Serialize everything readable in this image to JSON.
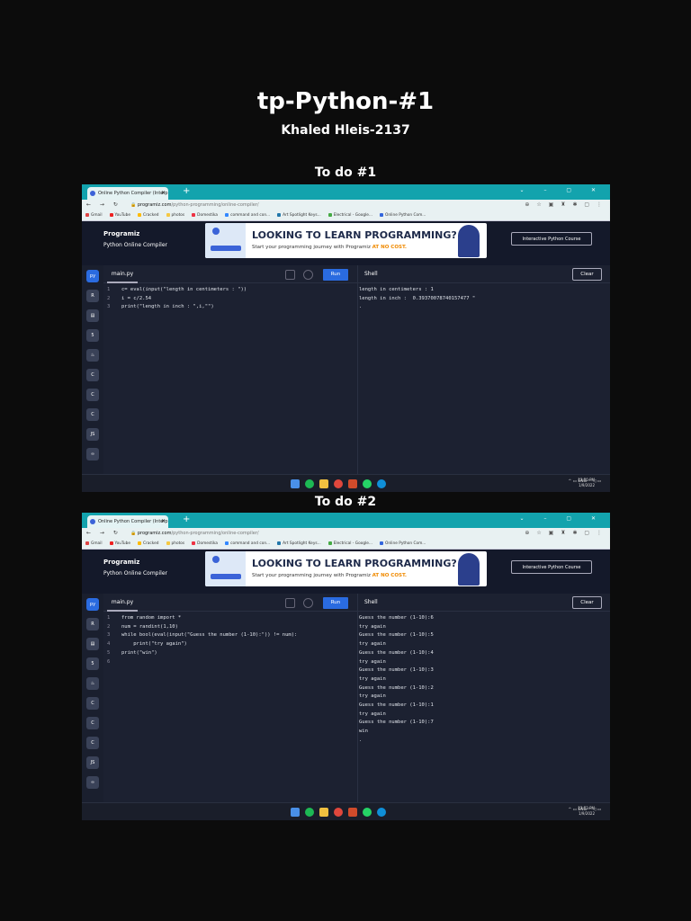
{
  "doc": {
    "title": "tp-Python-#1",
    "author": "Khaled Hleis-2137"
  },
  "sections": [
    {
      "label": "To do #1",
      "browser": {
        "tab_title": "Online Python Compiler (Interpr",
        "url_domain": "programiz.com",
        "url_path": "/python-programming/online-compiler/",
        "bookmarks": [
          "Gmail",
          "YouTube",
          "Cracked",
          "photos",
          "Domestika",
          "command and con...",
          "Art Spotlight Keys...",
          "Electrical - Google...",
          "Online Python Com..."
        ]
      },
      "site": {
        "logo": "Programiz",
        "subtitle": "Python Online Compiler",
        "banner_head": "LOOKING TO LEARN PROGRAMMING?",
        "banner_sub": "Start your programming journey with Programiz",
        "banner_sub_accent": "AT NO COST.",
        "cta": "Interactive Python Course"
      },
      "editor": {
        "tab": "main.py",
        "run": "Run",
        "shell": "Shell",
        "clear": "Clear",
        "lines": [
          "c= eval(input(\"length in centimeters : \"))",
          "i = c/2.54",
          "print(\"length in inch : \",i,\"\")"
        ]
      },
      "shell_lines": [
        "length in centimeters : 1",
        "length in inch :  0.39370078740157477 \"",
        "."
      ],
      "clock": {
        "time": "12:50 PM",
        "date": "1/9/2022"
      },
      "tray": "ENG"
    },
    {
      "label": "To do #2",
      "browser": {
        "tab_title": "Online Python Compiler (Interpr",
        "url_domain": "programiz.com",
        "url_path": "/python-programming/online-compiler/",
        "bookmarks": [
          "Gmail",
          "YouTube",
          "Cracked",
          "photos",
          "Domestika",
          "command and con...",
          "Art Spotlight Keys...",
          "Electrical - Google...",
          "Online Python Com..."
        ]
      },
      "site": {
        "logo": "Programiz",
        "subtitle": "Python Online Compiler",
        "banner_head": "LOOKING TO LEARN PROGRAMMING?",
        "banner_sub": "Start your programming journey with Programiz",
        "banner_sub_accent": "AT NO COST.",
        "cta": "Interactive Python Course"
      },
      "editor": {
        "tab": "main.py",
        "run": "Run",
        "shell": "Shell",
        "clear": "Clear",
        "lines": [
          "from random import *",
          "num = randint(1,10)",
          "while bool(eval(input(\"Guess the number (1-10):\")) != num):",
          "    print(\"try again\")",
          "print(\"win\")",
          ""
        ]
      },
      "shell_lines": [
        "Guess the number (1-10):6",
        "try again",
        "Guess the number (1-10):5",
        "try again",
        "Guess the number (1-10):4",
        "try again",
        "Guess the number (1-10):3",
        "try again",
        "Guess the number (1-10):2",
        "try again",
        "Guess the number (1-10):1",
        "try again",
        "Guess the number (1-10):7",
        "win",
        "."
      ],
      "clock": {
        "time": "12:53 PM",
        "date": "1/9/2022"
      },
      "tray": "ENG"
    }
  ],
  "colors": {
    "tabbar": "#13a3ad",
    "run": "#2a6be0",
    "banner_accent": "#f08a00"
  }
}
